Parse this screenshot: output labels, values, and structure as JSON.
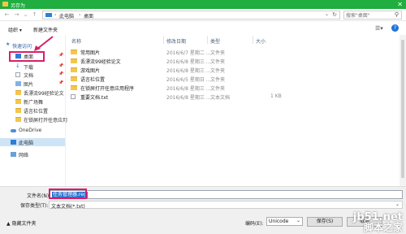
{
  "window": {
    "title": "另存为",
    "close_glyph": "✕"
  },
  "address": {
    "crumbs": [
      "此电脑",
      "桌面"
    ],
    "separator": "›",
    "search_placeholder": "搜索\"桌面\""
  },
  "toolbar": {
    "organize_label": "组织 ▾",
    "new_folder_label": "新建文件夹"
  },
  "nav": {
    "items": [
      {
        "label": "快速访问",
        "icon": "star-icon",
        "pinned": false
      },
      {
        "label": "桌面",
        "icon": "desktop-icon",
        "pinned": true
      },
      {
        "label": "下载",
        "icon": "download-icon",
        "pinned": true
      },
      {
        "label": "文档",
        "icon": "document-icon",
        "pinned": true
      },
      {
        "label": "图片",
        "icon": "picture-icon",
        "pinned": true
      },
      {
        "label": "丢漂流99经验论文",
        "icon": "folder-icon",
        "pinned": false
      },
      {
        "label": "新广场舞",
        "icon": "folder-icon",
        "pinned": false
      },
      {
        "label": "语言栏位置",
        "icon": "folder-icon",
        "pinned": false
      },
      {
        "label": "在锁屏打开任意应用",
        "icon": "folder-icon",
        "pinned": false
      },
      {
        "label": "OneDrive",
        "icon": "cloud-icon",
        "pinned": false
      },
      {
        "label": "此电脑",
        "icon": "computer-icon",
        "pinned": false
      },
      {
        "label": "网络",
        "icon": "network-icon",
        "pinned": false
      }
    ]
  },
  "columns": [
    "名称",
    "修改日期",
    "类型",
    "大小"
  ],
  "files": [
    {
      "name": "常用图片",
      "date": "2016/6/7 星期二 ...",
      "type": "文件夹",
      "size": "",
      "kind": "folder"
    },
    {
      "name": "丢漂流99经验论文",
      "date": "2016/6/8 星期三 ...",
      "type": "文件夹",
      "size": "",
      "kind": "folder"
    },
    {
      "name": "游戏图片",
      "date": "2016/6/8 星期三 ...",
      "type": "文件夹",
      "size": "",
      "kind": "folder"
    },
    {
      "name": "语言栏位置",
      "date": "2016/6/5 星期日 ...",
      "type": "文件夹",
      "size": "",
      "kind": "folder"
    },
    {
      "name": "在锁屏打开任意应用程序",
      "date": "2016/6/8 星期三 ...",
      "type": "文件夹",
      "size": "",
      "kind": "folder"
    },
    {
      "name": "重要文档.txt",
      "date": "2016/6/8 星期三 ...",
      "type": "文本文档",
      "size": "1 KB",
      "kind": "file"
    }
  ],
  "save": {
    "filename_label": "文件名(N):",
    "filename_value": "任务管理器.reg",
    "type_label": "保存类型(T):",
    "type_value": "文本文档(*.txt)",
    "hide_folders_label": "▲ 隐藏文件夹",
    "encoding_label": "编码(E):",
    "encoding_value": "Unicode",
    "save_button": "保存(S)",
    "cancel_button": "取消"
  },
  "watermark": {
    "line1": "jb51.net",
    "line2": "脚本之家"
  },
  "colors": {
    "titlebar": "#1fae3f",
    "highlight": "#d81f6a",
    "selection": "#2a6fd1",
    "folder": "#f3c74e"
  }
}
